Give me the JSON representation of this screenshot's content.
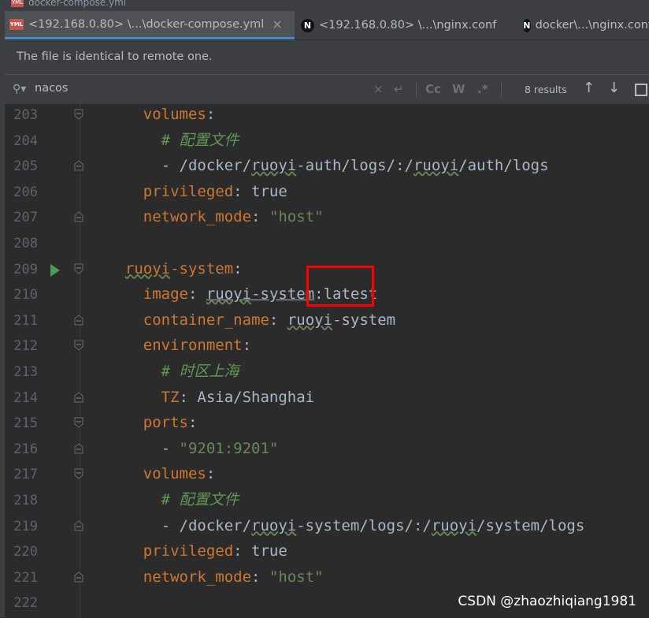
{
  "window": {
    "title": "docker-compose.yml"
  },
  "tabs": [
    {
      "label": "<192.168.0.80> \\...\\docker-compose.yml",
      "icon": "yml-file-icon",
      "icon_text": "YML",
      "active": true
    },
    {
      "label": "<192.168.0.80> \\...\\nginx.conf",
      "icon": "nginx-icon",
      "icon_text": "N",
      "active": false
    },
    {
      "label": "docker\\...\\nginx.conf",
      "icon": "nginx-icon",
      "icon_text": "N",
      "active": false
    }
  ],
  "banner": {
    "text": "The file is identical to remote one."
  },
  "search": {
    "query": "nacos",
    "results": "8 results",
    "btn_cc": "Cc",
    "btn_w": "W",
    "btn_regex": ".*"
  },
  "code_lines": [
    {
      "num": "203",
      "html": "    <span class=\"k\">volumes</span><span class=\"p\">:</span>"
    },
    {
      "num": "204",
      "html": "      <span class=\"c\"># 配置文件</span>"
    },
    {
      "num": "205",
      "html": "      <span class=\"p\">- /docker/<span class=\"u\">ruoyi</span>-auth/logs/:/<span class=\"u\">ruoyi</span>/auth/logs</span>"
    },
    {
      "num": "206",
      "html": "    <span class=\"k\">privileged</span><span class=\"p\">: true</span>"
    },
    {
      "num": "207",
      "html": "    <span class=\"k\">network_mode</span><span class=\"p\">: </span><span class=\"s\">\"host\"</span>"
    },
    {
      "num": "208",
      "html": ""
    },
    {
      "num": "209",
      "html": "  <span class=\"k\"><span class=\"u\">ruoyi</span>-system</span><span class=\"p\">:</span>"
    },
    {
      "num": "210",
      "html": "    <span class=\"k\">image</span><span class=\"p\">: <span class=\"ref\"><span class=\"u\">ruoyi</span>-system</span>:latest</span>"
    },
    {
      "num": "211",
      "html": "    <span class=\"k\">container_name</span><span class=\"p\">: <span class=\"u\">ruoyi</span>-system</span>"
    },
    {
      "num": "212",
      "html": "    <span class=\"k\">environment</span><span class=\"p\">:</span>"
    },
    {
      "num": "213",
      "html": "      <span class=\"c\"># 时区上海</span>"
    },
    {
      "num": "214",
      "html": "      <span class=\"k\">TZ</span><span class=\"p\">: Asia/Shanghai</span>"
    },
    {
      "num": "215",
      "html": "    <span class=\"k\">ports</span><span class=\"p\">:</span>"
    },
    {
      "num": "216",
      "html": "      <span class=\"p\">- </span><span class=\"s\">\"9201:9201\"</span>"
    },
    {
      "num": "217",
      "html": "    <span class=\"k\">volumes</span><span class=\"p\">:</span>"
    },
    {
      "num": "218",
      "html": "      <span class=\"c\"># 配置文件</span>"
    },
    {
      "num": "219",
      "html": "      <span class=\"p\">- /docker/<span class=\"u\">ruoyi</span>-system/logs/:/<span class=\"u\">ruoyi</span>/system/logs</span>"
    },
    {
      "num": "220",
      "html": "    <span class=\"k\">privileged</span><span class=\"p\">: true</span>"
    },
    {
      "num": "221",
      "html": "    <span class=\"k\">network_mode</span><span class=\"p\">: </span><span class=\"s\">\"host\"</span>"
    },
    {
      "num": "222",
      "html": ""
    }
  ],
  "watermark": "CSDN @zhaozhiqiang1981",
  "colors": {
    "keyword": "#cc7832",
    "string": "#6a8759",
    "comment": "#629755",
    "highlight": "#ff0000"
  }
}
